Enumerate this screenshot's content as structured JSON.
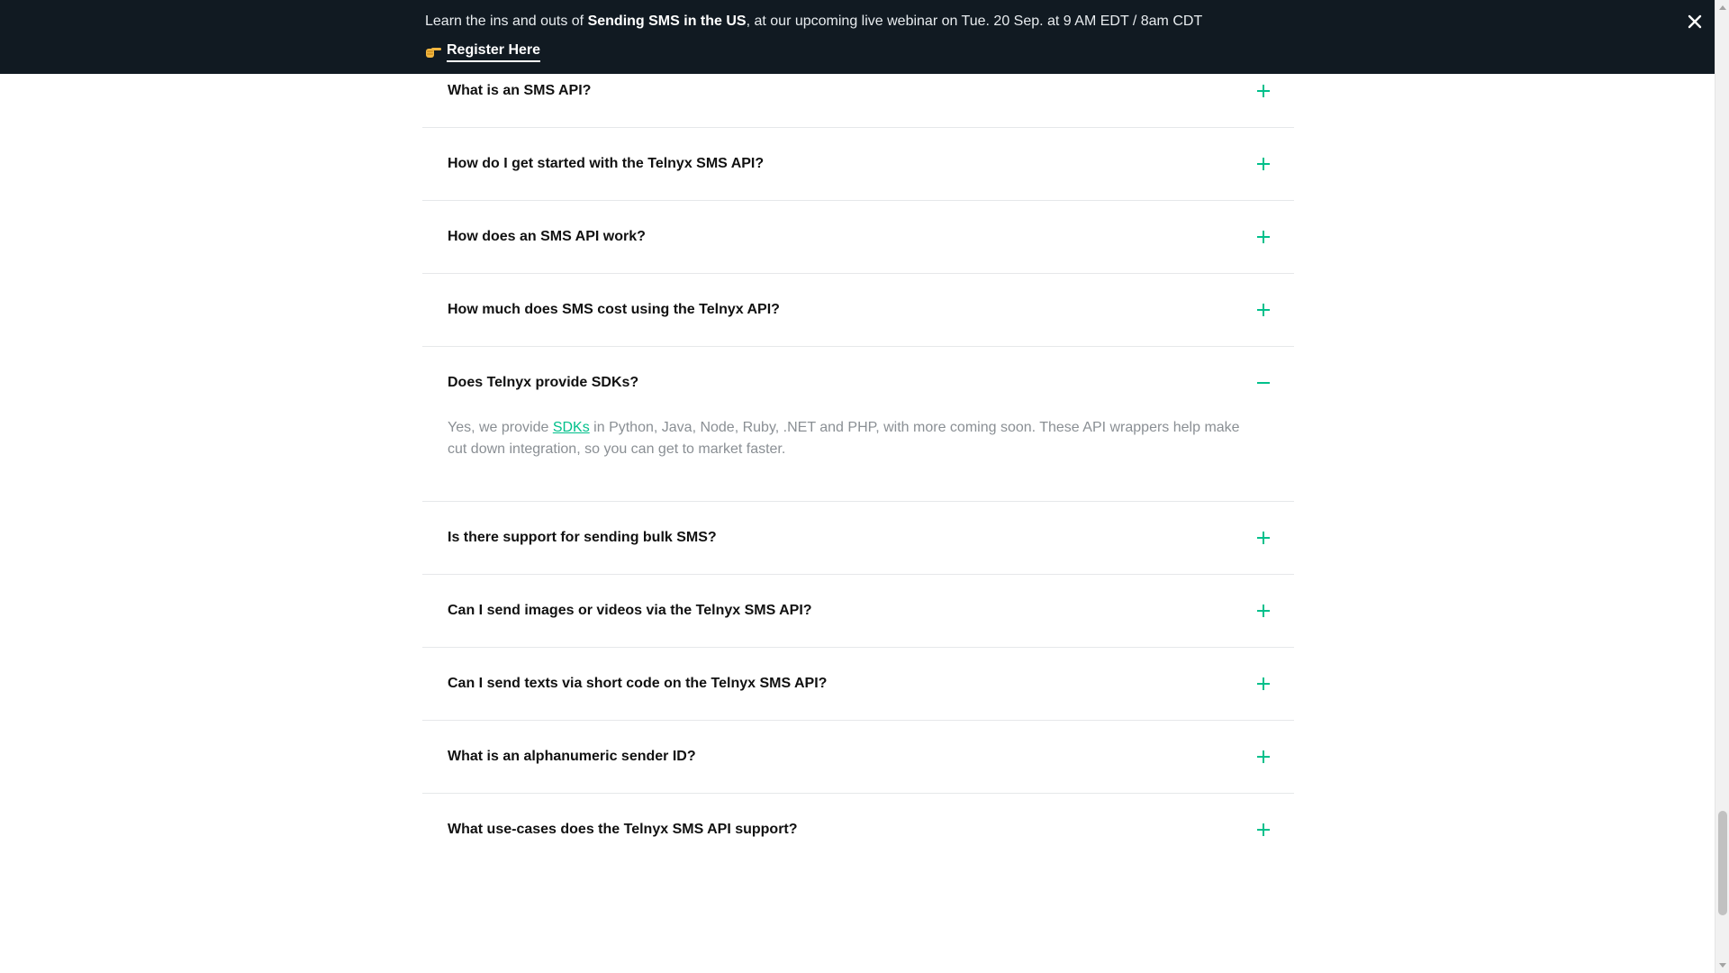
{
  "banner": {
    "text_prefix": "Learn the ins and outs of ",
    "text_bold": "Sending SMS in the US",
    "text_suffix": ", at our upcoming live webinar on Tue. 20 Sep. at 9 AM EDT / 8am CDT",
    "link_icon": "pointing-hand-icon",
    "link_label": "Register Here",
    "close_icon": "close-icon"
  },
  "faq": {
    "items": [
      {
        "question": "What is an SMS API?",
        "expanded": false,
        "toggle_icon": "plus-icon"
      },
      {
        "question": "How do I get started with the Telnyx SMS API?",
        "expanded": false,
        "toggle_icon": "plus-icon"
      },
      {
        "question": "How does an SMS API work?",
        "expanded": false,
        "toggle_icon": "plus-icon"
      },
      {
        "question": "How much does SMS cost using the Telnyx API?",
        "expanded": false,
        "toggle_icon": "plus-icon"
      },
      {
        "question": "Does Telnyx provide SDKs?",
        "expanded": true,
        "toggle_icon": "minus-icon",
        "answer_prefix": "Yes, we provide ",
        "answer_link": "SDKs",
        "answer_suffix": " in Python, Java, Node, Ruby, .NET and PHP, with more coming soon. These API wrappers help make cut down integration, so you can get to market faster."
      },
      {
        "question": "Is there support for sending bulk SMS?",
        "expanded": false,
        "toggle_icon": "plus-icon"
      },
      {
        "question": "Can I send images or videos via the Telnyx SMS API?",
        "expanded": false,
        "toggle_icon": "plus-icon"
      },
      {
        "question": "Can I send texts via short code on the Telnyx SMS API?",
        "expanded": false,
        "toggle_icon": "plus-icon"
      },
      {
        "question": "What is an alphanumeric sender ID?",
        "expanded": false,
        "toggle_icon": "plus-icon"
      },
      {
        "question": "What use-cases does the Telnyx SMS API support?",
        "expanded": false,
        "toggle_icon": "plus-icon"
      }
    ]
  },
  "colors": {
    "banner_bg": "#111a22",
    "accent": "#00c08b",
    "divider": "#e6e8ea",
    "answer_text": "#8a8f94"
  }
}
